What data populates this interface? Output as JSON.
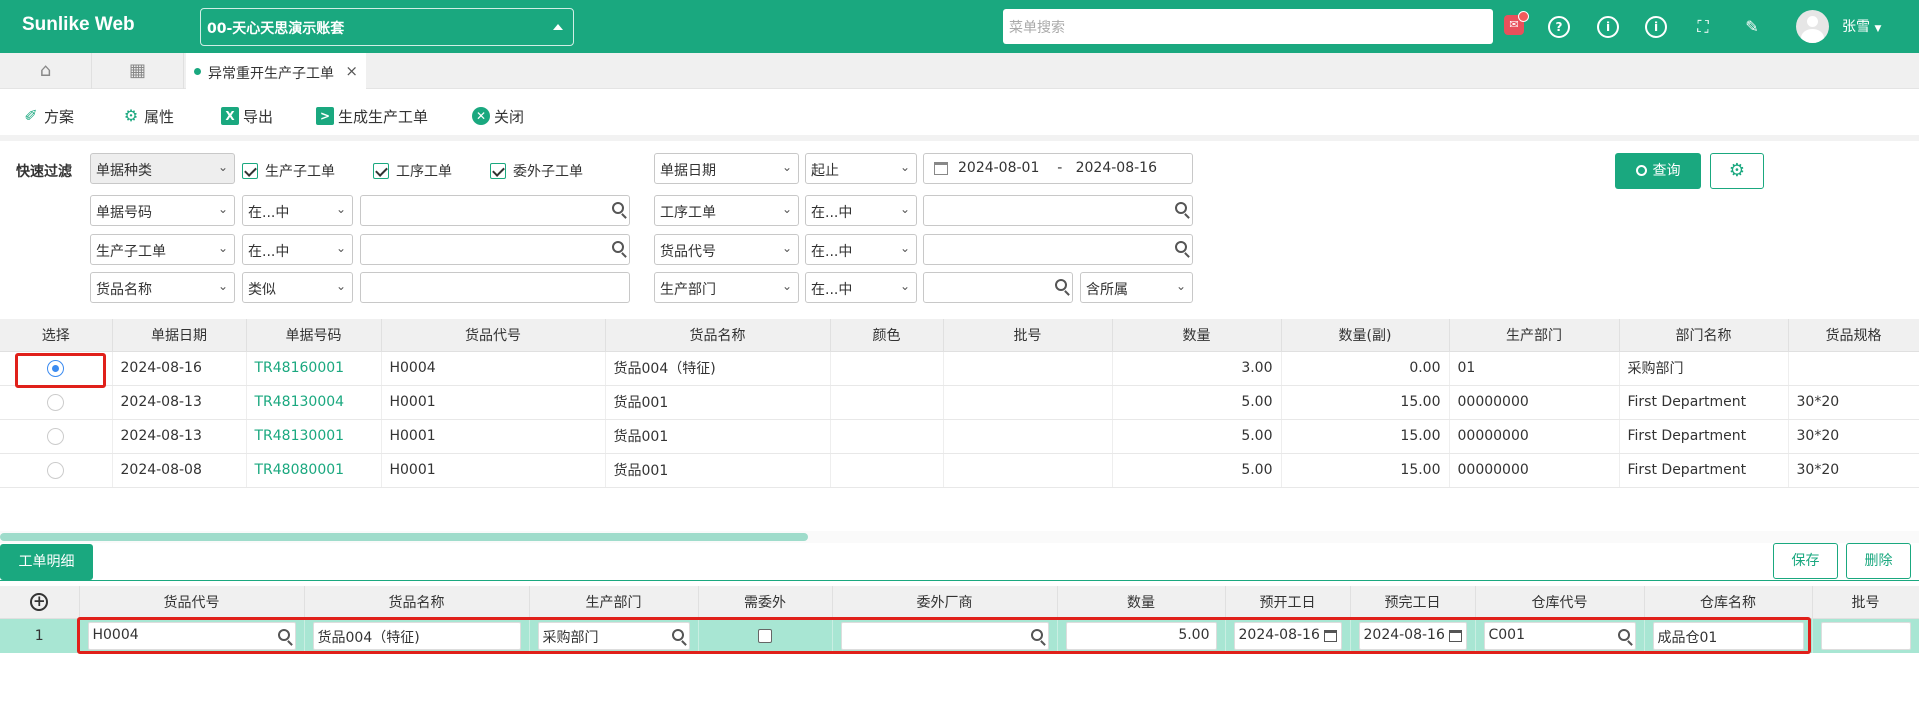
{
  "header": {
    "logo": "Sunlike Web",
    "account": "00-天心天思演示账套",
    "menu_search_placeholder": "菜单搜索",
    "user": "张雪",
    "badge": "✉"
  },
  "tabs": {
    "active": "异常重开生产子工单"
  },
  "toolbar": {
    "scheme": "方案",
    "props": "属性",
    "export": "导出",
    "generate": "生成生产工单",
    "close": "关闭"
  },
  "filter": {
    "label": "快速过滤",
    "doc_type": "单据种类",
    "checks": [
      "生产子工单",
      "工序工单",
      "委外子工单"
    ],
    "date_field": "单据日期",
    "date_mode": "起止",
    "date_from": "2024-08-01",
    "date_sep": "-",
    "date_to": "2024-08-16",
    "row2": {
      "f1": "单据号码",
      "op1": "在...中",
      "f2": "工序工单",
      "op2": "在...中"
    },
    "row3": {
      "f1": "生产子工单",
      "op1": "在...中",
      "f2": "货品代号",
      "op2": "在...中"
    },
    "row4": {
      "f1": "货品名称",
      "op1": "类似",
      "f2": "生产部门",
      "op2": "在...中",
      "extra": "含所属"
    },
    "query": "查询"
  },
  "grid": {
    "headers": [
      "选择",
      "单据日期",
      "单据号码",
      "货品代号",
      "货品名称",
      "颜色",
      "批号",
      "数量",
      "数量(副)",
      "生产部门",
      "部门名称",
      "货品规格"
    ],
    "rows": [
      {
        "date": "2024-08-16",
        "no": "TR48160001",
        "code": "H0004",
        "name": "货品004（特征)",
        "qty": "3.00",
        "qty2": "0.00",
        "dept": "01",
        "dept_name": "采购部门",
        "spec": ""
      },
      {
        "date": "2024-08-13",
        "no": "TR48130004",
        "code": "H0001",
        "name": "货品001",
        "qty": "5.00",
        "qty2": "15.00",
        "dept": "00000000",
        "dept_name": "First Department",
        "spec": "30*20"
      },
      {
        "date": "2024-08-13",
        "no": "TR48130001",
        "code": "H0001",
        "name": "货品001",
        "qty": "5.00",
        "qty2": "15.00",
        "dept": "00000000",
        "dept_name": "First Department",
        "spec": "30*20"
      },
      {
        "date": "2024-08-08",
        "no": "TR48080001",
        "code": "H0001",
        "name": "货品001",
        "qty": "5.00",
        "qty2": "15.00",
        "dept": "00000000",
        "dept_name": "First Department",
        "spec": "30*20"
      }
    ]
  },
  "detail": {
    "tab": "工单明细",
    "save": "保存",
    "delete": "删除",
    "headers": [
      "货品代号",
      "货品名称",
      "生产部门",
      "需委外",
      "委外厂商",
      "数量",
      "预开工日",
      "预完工日",
      "仓库代号",
      "仓库名称",
      "批号"
    ],
    "row": {
      "idx": "1",
      "code": "H0004",
      "name": "货品004（特征)",
      "dept": "采购部门",
      "vendor": "",
      "qty": "5.00",
      "start": "2024-08-16",
      "end": "2024-08-16",
      "wh_code": "C001",
      "wh_name": "成品仓01",
      "batch": ""
    }
  }
}
